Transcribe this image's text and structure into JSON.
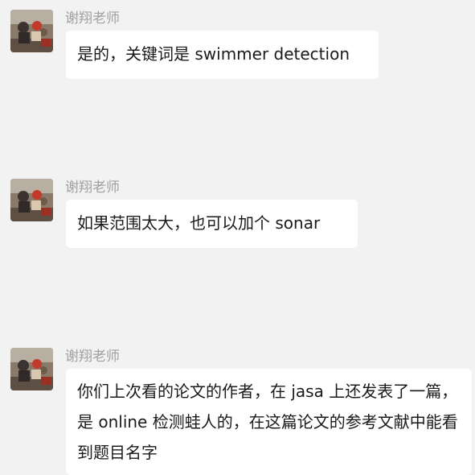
{
  "messages": [
    {
      "sender": "谢翔老师",
      "text": "是的，关键词是 swimmer detection"
    },
    {
      "sender": "谢翔老师",
      "text": "如果范围太大，也可以加个 sonar"
    },
    {
      "sender": "谢翔老师",
      "text": "你们上次看的论文的作者，在 jasa 上还发表了一篇，是 online 检测蛙人的，在这篇论文的参考文献中能看到题目名字"
    }
  ],
  "colors": {
    "background": "#f2f2f2",
    "bubble": "#ffffff",
    "sender_name": "#a0a0a0",
    "message_text": "#1a1a1a"
  },
  "icons": {
    "avatar": "avatar-photo"
  }
}
